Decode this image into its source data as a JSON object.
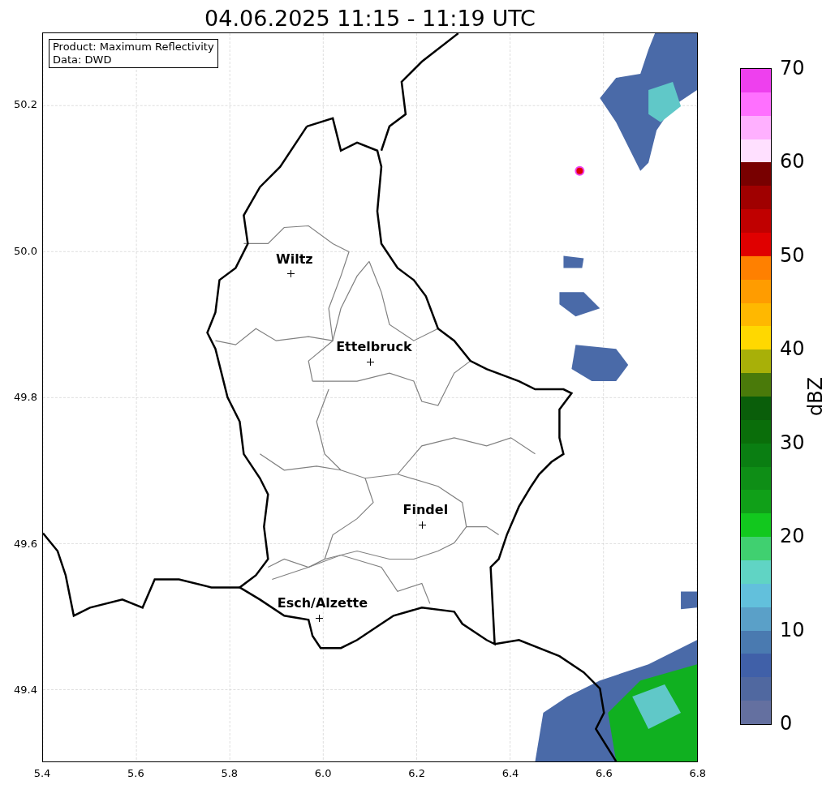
{
  "title": "04.06.2025 11:15 - 11:19 UTC",
  "info_box": [
    "Product: Maximum Reflectivity",
    "Data: DWD"
  ],
  "cities": [
    {
      "name": "Wiltz"
    },
    {
      "name": "Ettelbruck"
    },
    {
      "name": "Findel"
    },
    {
      "name": "Esch/Alzette"
    }
  ],
  "x_ticks": [
    "5.4",
    "5.6",
    "5.8",
    "6.0",
    "6.2",
    "6.4",
    "6.6",
    "6.8"
  ],
  "y_ticks": [
    "50.2",
    "50.0",
    "49.8",
    "49.6",
    "49.4"
  ],
  "colorbar": {
    "label": "dBZ",
    "ticks": [
      "70",
      "60",
      "50",
      "40",
      "30",
      "20",
      "10",
      "0"
    ],
    "bands": [
      {
        "color": "#6470a0"
      },
      {
        "color": "#5068a0"
      },
      {
        "color": "#4060a8"
      },
      {
        "color": "#4a7ab0"
      },
      {
        "color": "#5aa0c8"
      },
      {
        "color": "#62c0dc"
      },
      {
        "color": "#60d4c4"
      },
      {
        "color": "#40d070"
      },
      {
        "color": "#12c81e"
      },
      {
        "color": "#10a018"
      },
      {
        "color": "#0e8e16"
      },
      {
        "color": "#0a7e12"
      },
      {
        "color": "#0a6e0a"
      },
      {
        "color": "#0a5e0a"
      },
      {
        "color": "#4a7a0a"
      },
      {
        "color": "#a8b008"
      },
      {
        "color": "#ffd800"
      },
      {
        "color": "#ffb800"
      },
      {
        "color": "#ff9c00"
      },
      {
        "color": "#ff8000"
      },
      {
        "color": "#e00000"
      },
      {
        "color": "#c00000"
      },
      {
        "color": "#a00000"
      },
      {
        "color": "#780000"
      },
      {
        "color": "#ffe0ff"
      },
      {
        "color": "#ffb0ff"
      },
      {
        "color": "#ff70ff"
      },
      {
        "color": "#ee40ee"
      }
    ]
  }
}
